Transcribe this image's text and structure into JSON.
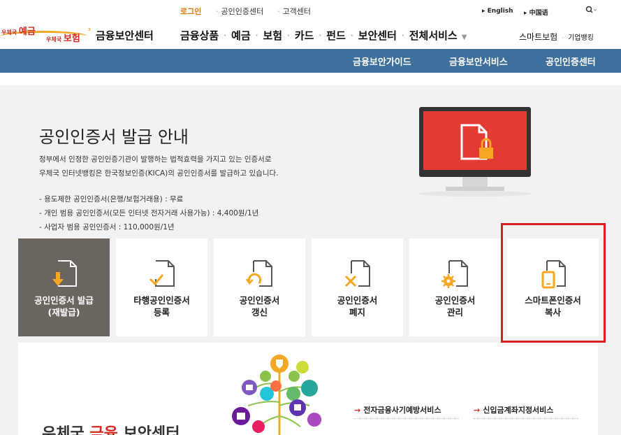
{
  "util": {
    "login": "로그인",
    "cert_center": "공인인증센터",
    "customer_center": "고객센터",
    "english": "English",
    "chinese": "中国语"
  },
  "logo": {
    "deposit_prefix": "우체국",
    "deposit": "예금",
    "insurance_prefix": "우체국",
    "insurance": "보험",
    "center_title": "금융보안센터"
  },
  "gnb": {
    "items": [
      "금융상품",
      "예금",
      "보험",
      "카드",
      "펀드",
      "보안센터",
      "전체서비스"
    ],
    "smart_insurance": "스마트보험",
    "corporate_banking": "기업뱅킹"
  },
  "subnav": {
    "items": [
      "금융보안가이드",
      "금융보안서비스",
      "공인인증센터"
    ]
  },
  "intro": {
    "title": "공인인증서 발급 안내",
    "desc_line1": "정부에서 인정한 공인인증기관이 발행하는 법적효력을 가지고 있는 인증서로",
    "desc_line2": "우체국 인터넷뱅킹은 한국정보인증(KICA)의 공인인증서를 발급하고 있습니다.",
    "fee_line1": "- 용도제한 공인인증서(은행/보험거래용) : 무료",
    "fee_line2": "- 개인 범용 공인인증서(모든 인터넷 전자거래 사용가능) : 4,400원/1년",
    "fee_line3": "- 사업자 범용 공인인증서 : 110,000원/1년"
  },
  "tiles": [
    {
      "line1": "공인인증서 발급",
      "line2": "(재발급)",
      "icon": "download-document-icon"
    },
    {
      "line1": "타행공인인증서",
      "line2": "등록",
      "icon": "check-document-icon"
    },
    {
      "line1": "공인인증서",
      "line2": "갱신",
      "icon": "renew-document-icon"
    },
    {
      "line1": "공인인증서",
      "line2": "폐지",
      "icon": "delete-document-icon"
    },
    {
      "line1": "공인인증서",
      "line2": "관리",
      "icon": "gear-document-icon"
    },
    {
      "line1": "스마트폰인증서",
      "line2": "복사",
      "icon": "smartphone-document-icon"
    }
  ],
  "lower": {
    "link1": "전자금융사기예방서비스",
    "link2": "신입금계좌지정서비스",
    "heading_part1": "우체국",
    "heading_part2": "금융",
    "heading_part3": "보안센터"
  },
  "colors": {
    "accent_red": "#d52b1e",
    "subnav_blue": "#3f6f9c",
    "active_tile": "#6b6560",
    "icon_orange": "#f5a623",
    "highlight_box": "#d81e1e"
  }
}
